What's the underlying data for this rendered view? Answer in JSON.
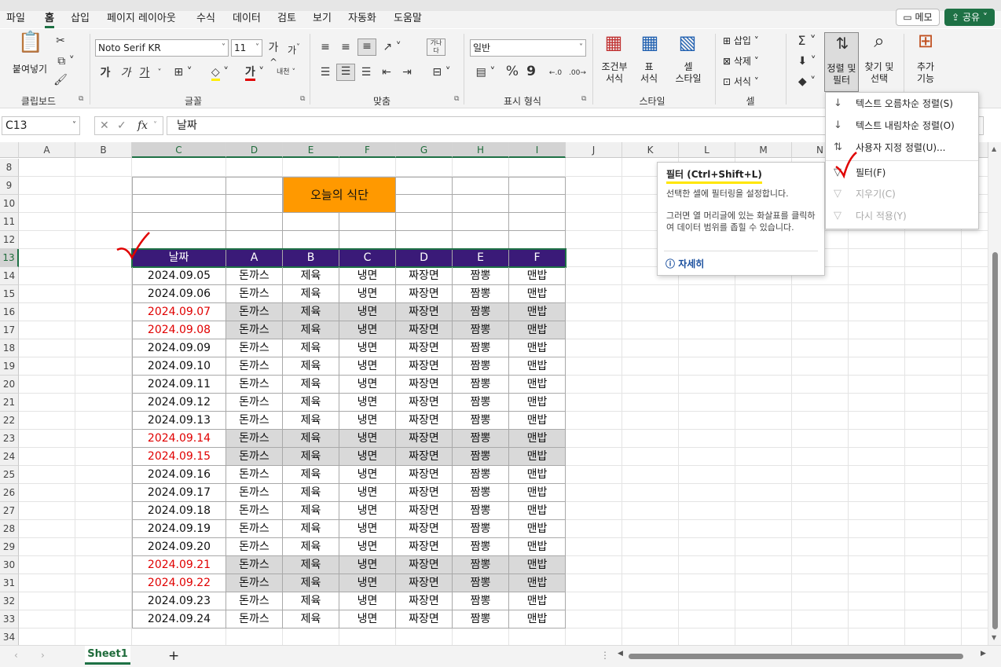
{
  "menu": {
    "items": [
      "파일",
      "홈",
      "삽입",
      "페이지 레이아웃",
      "수식",
      "데이터",
      "검토",
      "보기",
      "자동화",
      "도움말"
    ],
    "memo_label": "메모",
    "share_label": "공유"
  },
  "ribbon": {
    "clipboard": {
      "paste_label": "붙여넣기",
      "group_label": "클립보드"
    },
    "font": {
      "font_name": "Noto Serif KR",
      "font_size": "11",
      "group_label": "글꼴",
      "bold": "가",
      "italic": "가",
      "underline": "가",
      "grow": "가",
      "shrink": "가",
      "color_char": "가",
      "phonetic": "내천"
    },
    "alignment": {
      "group_label": "맞춤",
      "wrap": "가나다"
    },
    "number": {
      "format": "일반",
      "group_label": "표시 형식",
      "percent": "%",
      "comma": "9"
    },
    "styles": {
      "conditional_label": "조건부\n서식",
      "table_label": "표\n서식",
      "cell_style_label": "셀\n스타일",
      "group_label": "스타일"
    },
    "cells": {
      "insert_label": "삽입",
      "delete_label": "삭제",
      "format_label": "서식",
      "group_label": "셀"
    },
    "editing": {
      "sort_filter_label": "정렬 및\n필터",
      "find_label": "찾기 및\n선택"
    },
    "addins": {
      "label": "추가\n기능"
    }
  },
  "formula_bar": {
    "name_box": "C13",
    "fx": "fx",
    "content": "날짜"
  },
  "columns": [
    "A",
    "B",
    "C",
    "D",
    "E",
    "F",
    "G",
    "H",
    "I",
    "J",
    "K",
    "L",
    "M",
    "N"
  ],
  "rows": [
    "8",
    "9",
    "10",
    "11",
    "12",
    "13",
    "14",
    "15",
    "16",
    "17",
    "18",
    "19",
    "20",
    "21",
    "22",
    "23",
    "24",
    "25",
    "26",
    "27",
    "28",
    "29",
    "30",
    "31",
    "32",
    "33",
    "34"
  ],
  "table": {
    "title": "오늘의 식단",
    "headers": [
      "날짜",
      "A",
      "B",
      "C",
      "D",
      "E",
      "F"
    ],
    "rows": [
      {
        "date": "2024.09.05",
        "menu": [
          "돈까스",
          "제육",
          "냉면",
          "짜장면",
          "짬뽕",
          "맨밥"
        ],
        "weekend": false
      },
      {
        "date": "2024.09.06",
        "menu": [
          "돈까스",
          "제육",
          "냉면",
          "짜장면",
          "짬뽕",
          "맨밥"
        ],
        "weekend": false
      },
      {
        "date": "2024.09.07",
        "menu": [
          "돈까스",
          "제육",
          "냉면",
          "짜장면",
          "짬뽕",
          "맨밥"
        ],
        "weekend": true
      },
      {
        "date": "2024.09.08",
        "menu": [
          "돈까스",
          "제육",
          "냉면",
          "짜장면",
          "짬뽕",
          "맨밥"
        ],
        "weekend": true
      },
      {
        "date": "2024.09.09",
        "menu": [
          "돈까스",
          "제육",
          "냉면",
          "짜장면",
          "짬뽕",
          "맨밥"
        ],
        "weekend": false
      },
      {
        "date": "2024.09.10",
        "menu": [
          "돈까스",
          "제육",
          "냉면",
          "짜장면",
          "짬뽕",
          "맨밥"
        ],
        "weekend": false
      },
      {
        "date": "2024.09.11",
        "menu": [
          "돈까스",
          "제육",
          "냉면",
          "짜장면",
          "짬뽕",
          "맨밥"
        ],
        "weekend": false
      },
      {
        "date": "2024.09.12",
        "menu": [
          "돈까스",
          "제육",
          "냉면",
          "짜장면",
          "짬뽕",
          "맨밥"
        ],
        "weekend": false
      },
      {
        "date": "2024.09.13",
        "menu": [
          "돈까스",
          "제육",
          "냉면",
          "짜장면",
          "짬뽕",
          "맨밥"
        ],
        "weekend": false
      },
      {
        "date": "2024.09.14",
        "menu": [
          "돈까스",
          "제육",
          "냉면",
          "짜장면",
          "짬뽕",
          "맨밥"
        ],
        "weekend": true
      },
      {
        "date": "2024.09.15",
        "menu": [
          "돈까스",
          "제육",
          "냉면",
          "짜장면",
          "짬뽕",
          "맨밥"
        ],
        "weekend": true
      },
      {
        "date": "2024.09.16",
        "menu": [
          "돈까스",
          "제육",
          "냉면",
          "짜장면",
          "짬뽕",
          "맨밥"
        ],
        "weekend": false
      },
      {
        "date": "2024.09.17",
        "menu": [
          "돈까스",
          "제육",
          "냉면",
          "짜장면",
          "짬뽕",
          "맨밥"
        ],
        "weekend": false
      },
      {
        "date": "2024.09.18",
        "menu": [
          "돈까스",
          "제육",
          "냉면",
          "짜장면",
          "짬뽕",
          "맨밥"
        ],
        "weekend": false
      },
      {
        "date": "2024.09.19",
        "menu": [
          "돈까스",
          "제육",
          "냉면",
          "짜장면",
          "짬뽕",
          "맨밥"
        ],
        "weekend": false
      },
      {
        "date": "2024.09.20",
        "menu": [
          "돈까스",
          "제육",
          "냉면",
          "짜장면",
          "짬뽕",
          "맨밥"
        ],
        "weekend": false
      },
      {
        "date": "2024.09.21",
        "menu": [
          "돈까스",
          "제육",
          "냉면",
          "짜장면",
          "짬뽕",
          "맨밥"
        ],
        "weekend": true
      },
      {
        "date": "2024.09.22",
        "menu": [
          "돈까스",
          "제육",
          "냉면",
          "짜장면",
          "짬뽕",
          "맨밥"
        ],
        "weekend": true
      },
      {
        "date": "2024.09.23",
        "menu": [
          "돈까스",
          "제육",
          "냉면",
          "짜장면",
          "짬뽕",
          "맨밥"
        ],
        "weekend": false
      },
      {
        "date": "2024.09.24",
        "menu": [
          "돈까스",
          "제육",
          "냉면",
          "짜장면",
          "짬뽕",
          "맨밥"
        ],
        "weekend": false
      }
    ]
  },
  "dropdown": {
    "items": [
      {
        "label": "텍스트 오름차순 정렬(S)",
        "disabled": false,
        "icon": "sort-asc-icon"
      },
      {
        "label": "텍스트 내림차순 정렬(O)",
        "disabled": false,
        "icon": "sort-desc-icon"
      },
      {
        "label": "사용자 지정 정렬(U)...",
        "disabled": false,
        "icon": "custom-sort-icon"
      },
      {
        "label": "필터(F)",
        "disabled": false,
        "icon": "filter-icon"
      },
      {
        "label": "지우기(C)",
        "disabled": true,
        "icon": "clear-filter-icon"
      },
      {
        "label": "다시 적용(Y)",
        "disabled": true,
        "icon": "reapply-icon"
      }
    ]
  },
  "tooltip": {
    "title": "필터 (Ctrl+Shift+L)",
    "line1": "선택한 셀에 필터링을 설정합니다.",
    "line2": "그러면 열 머리글에 있는 화살표를 클릭하여 데이터 범위를 좁힐 수 있습니다.",
    "more": "자세히"
  },
  "sheet_tabs": {
    "active": "Sheet1",
    "add": "+"
  },
  "colors": {
    "accent": "#1e7145",
    "header_bg": "#3a1a78",
    "title_bg": "#ff9900",
    "weekend_text": "#e00000",
    "weekend_bg": "#d9d9d9"
  }
}
